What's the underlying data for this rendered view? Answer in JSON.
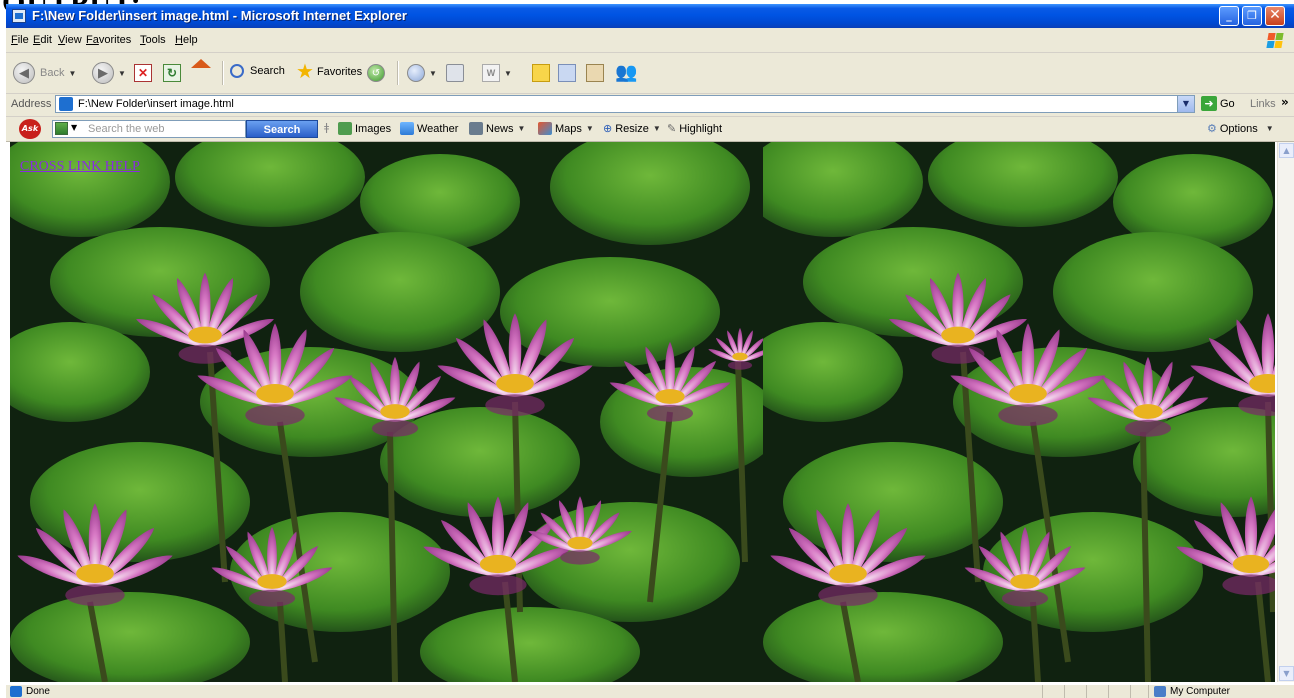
{
  "heading_top": "OUTPUT:",
  "window": {
    "title": "F:\\New Folder\\insert image.html - Microsoft Internet Explorer"
  },
  "menu": [
    {
      "first": "F",
      "rest": "ile"
    },
    {
      "first": "E",
      "rest": "dit"
    },
    {
      "first": "V",
      "rest": "iew"
    },
    {
      "first": "Fa",
      "rest": "vorites"
    },
    {
      "first": "T",
      "rest": "ools"
    },
    {
      "first": "H",
      "rest": "elp"
    }
  ],
  "toolbar": {
    "back_label": "Back",
    "search_label": "Search",
    "favorites_label": "Favorites"
  },
  "address": {
    "label": "Address",
    "url": "F:\\New Folder\\insert image.html",
    "go_label": "Go",
    "links_label": "Links"
  },
  "ask": {
    "logo": "Ask",
    "search_placeholder": "Search the web",
    "search_button": "Search",
    "images": "Images",
    "weather": "Weather",
    "news": "News",
    "maps": "Maps",
    "resize": "Resize",
    "highlight": "Highlight",
    "options": "Options"
  },
  "page": {
    "link_text": "CROSS LINK HELP"
  },
  "status": {
    "text": "Done",
    "zone": "My Computer"
  },
  "colors": {
    "titlebar": "#0054e3",
    "visited_link": "#8a2be2",
    "chrome": "#ece9d8"
  }
}
